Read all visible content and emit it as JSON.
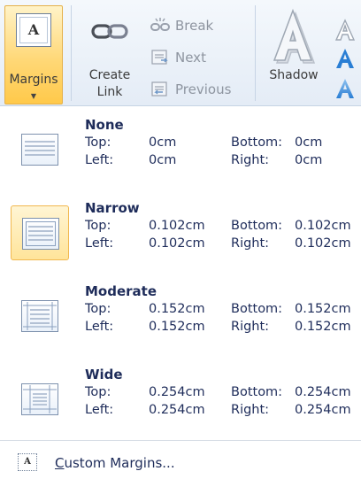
{
  "ribbon": {
    "margins": {
      "icon_letter": "A",
      "label": "Margins",
      "caret": "▼"
    },
    "create_link": {
      "line1": "Create",
      "line2": "Link"
    },
    "break_label": "Break",
    "next_label": "Next",
    "previous_label": "Previous",
    "shadow_label": "Shadow",
    "accent_color": "#2a7ed4",
    "selected_color": "#ffd877"
  },
  "menu": {
    "items": [
      {
        "title": "None",
        "top_label": "Top:",
        "top_value": "0cm",
        "bottom_label": "Bottom:",
        "bottom_value": "0cm",
        "left_label": "Left:",
        "left_value": "0cm",
        "right_label": "Right:",
        "right_value": "0cm",
        "selected": false
      },
      {
        "title": "Narrow",
        "top_label": "Top:",
        "top_value": "0.102cm",
        "bottom_label": "Bottom:",
        "bottom_value": "0.102cm",
        "left_label": "Left:",
        "left_value": "0.102cm",
        "right_label": "Right:",
        "right_value": "0.102cm",
        "selected": true
      },
      {
        "title": "Moderate",
        "top_label": "Top:",
        "top_value": "0.152cm",
        "bottom_label": "Bottom:",
        "bottom_value": "0.152cm",
        "left_label": "Left:",
        "left_value": "0.152cm",
        "right_label": "Right:",
        "right_value": "0.152cm",
        "selected": false
      },
      {
        "title": "Wide",
        "top_label": "Top:",
        "top_value": "0.254cm",
        "bottom_label": "Bottom:",
        "bottom_value": "0.254cm",
        "left_label": "Left:",
        "left_value": "0.254cm",
        "right_label": "Right:",
        "right_value": "0.254cm",
        "selected": false
      }
    ],
    "custom": {
      "icon_letter": "A",
      "mnemonic": "C",
      "label_rest": "ustom Margins..."
    }
  }
}
